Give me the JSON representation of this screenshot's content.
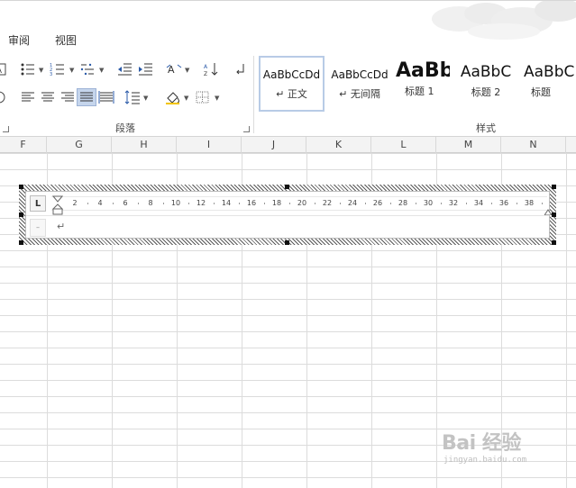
{
  "tabs": [
    {
      "label": "审阅"
    },
    {
      "label": "视图"
    }
  ],
  "ribbon": {
    "paragraph_group": {
      "label": "段落"
    },
    "styles_group": {
      "label": "样式"
    },
    "styles": [
      {
        "sample": "AaBbCcDd",
        "name": "↵ 正文",
        "selected": true
      },
      {
        "sample": "AaBbCcDd",
        "name": "↵ 无间隔",
        "selected": false
      },
      {
        "sample": "AaBb",
        "name": "标题 1",
        "selected": false
      },
      {
        "sample": "AaBbC",
        "name": "标题 2",
        "selected": false
      },
      {
        "sample": "AaBbC",
        "name": "标题",
        "selected": false
      }
    ]
  },
  "sheet": {
    "columns": [
      "F",
      "G",
      "H",
      "I",
      "J",
      "K",
      "L",
      "M",
      "N"
    ]
  },
  "textbox": {
    "tab_selector": "L",
    "ruler_numbers": [
      "2",
      "4",
      "6",
      "8",
      "10",
      "12",
      "14",
      "16",
      "18",
      "20",
      "22",
      "24",
      "26",
      "28",
      "30",
      "32",
      "34",
      "36",
      "38"
    ],
    "vruler_mark": "–",
    "paragraph_mark": "↵"
  },
  "watermark": {
    "brand": "Bai 经验",
    "url": "jingyan.baidu.com"
  },
  "colors": {
    "selected_button": "#c5d5ec",
    "selection_hatch": "#5a5a5a"
  }
}
